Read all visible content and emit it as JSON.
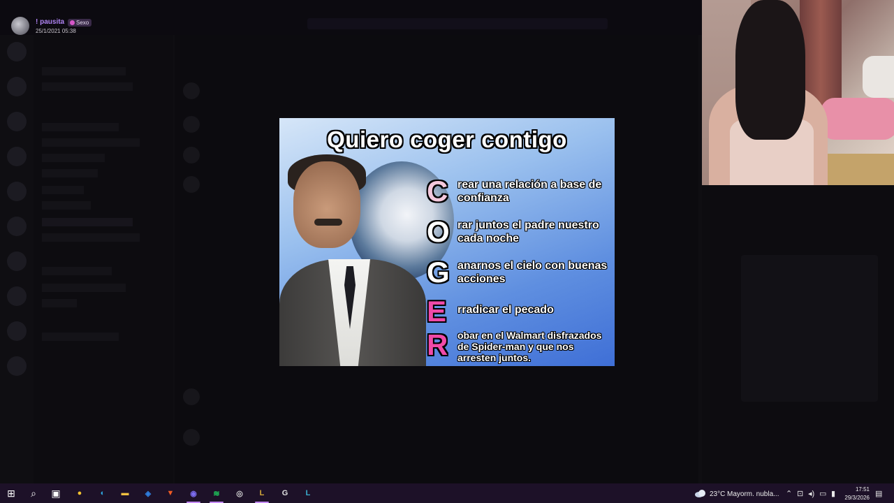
{
  "post": {
    "username": "! pausita",
    "role": "Sexo",
    "timestamp": "25/1/2021 05:38"
  },
  "meme": {
    "title": "Quiero coger contigo",
    "acrostic": [
      {
        "letter": "C",
        "color": "#f4c8dc",
        "text": "rear una relación a base de confianza"
      },
      {
        "letter": "O",
        "color": "#ffffff",
        "text": "rar juntos el padre nuestro cada noche"
      },
      {
        "letter": "G",
        "color": "#ffffff",
        "text": "anarnos el cielo con buenas acciones"
      },
      {
        "letter": "E",
        "color": "#f04aa8",
        "text": "rradicar el pecado"
      },
      {
        "letter": "R",
        "color": "#f04aa8",
        "text": "obar en el Walmart disfrazados de Spider-man y que nos arresten juntos."
      }
    ]
  },
  "taskbar": {
    "apps": [
      {
        "name": "start",
        "glyph": "⊞",
        "color": "#ffffff"
      },
      {
        "name": "search",
        "glyph": "⌕",
        "color": "#ffffff"
      },
      {
        "name": "task-view",
        "glyph": "▣",
        "color": "#ffffff"
      },
      {
        "name": "chrome",
        "glyph": "●",
        "color": "#f2c230"
      },
      {
        "name": "edge",
        "glyph": "◐",
        "color": "#2fa8e0"
      },
      {
        "name": "file-explorer",
        "glyph": "▬",
        "color": "#f0c040"
      },
      {
        "name": "store",
        "glyph": "◈",
        "color": "#2f7fe0"
      },
      {
        "name": "brave",
        "glyph": "▼",
        "color": "#f05a24"
      },
      {
        "name": "discord",
        "glyph": "◉",
        "color": "#7c6cf0"
      },
      {
        "name": "spotify",
        "glyph": "≋",
        "color": "#1ed760"
      },
      {
        "name": "app-circle",
        "glyph": "◎",
        "color": "#d0d0d0"
      },
      {
        "name": "league-client",
        "glyph": "L",
        "color": "#d6a93a"
      },
      {
        "name": "app-g",
        "glyph": "G",
        "color": "#e0e0e0"
      },
      {
        "name": "league-game",
        "glyph": "L",
        "color": "#3ab0d0"
      }
    ],
    "weather_temp": "23°C",
    "weather_condition": "Mayorm. nubla...",
    "time": "17:51",
    "date": "29/3/2026"
  }
}
